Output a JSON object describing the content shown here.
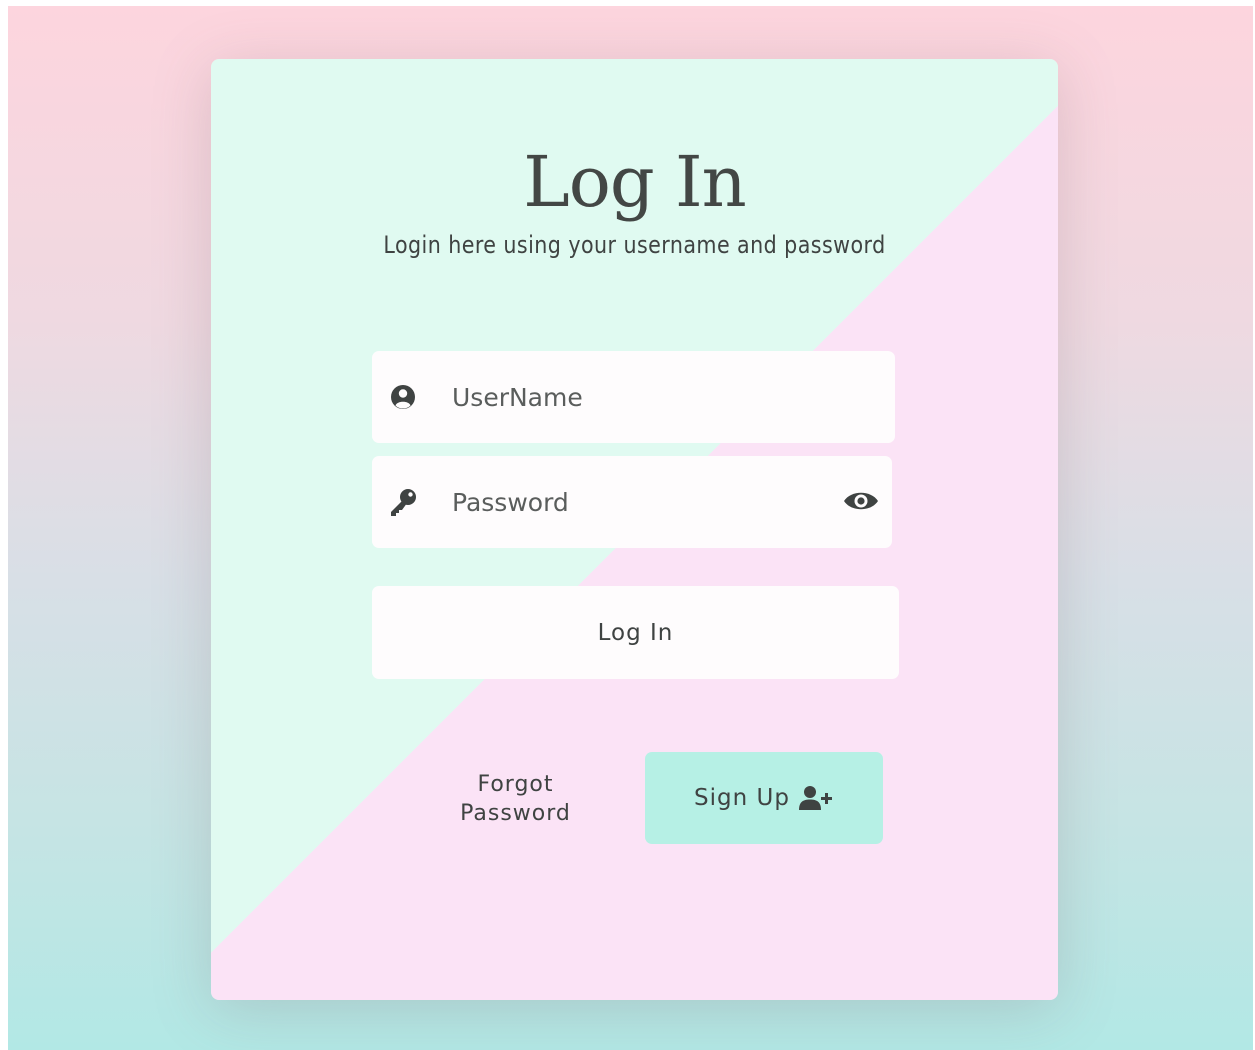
{
  "login": {
    "title": "Log In",
    "subtitle": "Login here using your username and password",
    "username_placeholder": "UserName",
    "password_placeholder": "Password",
    "submit_label": "Log In",
    "forgot_line1": "Forgot",
    "forgot_line2": "Password",
    "signup_label": "Sign Up"
  },
  "icons": {
    "username": "user-circle-icon",
    "password": "key-icon",
    "toggle": "eye-icon",
    "signup": "user-plus-icon"
  },
  "colors": {
    "card_mint": "#e0faf1",
    "card_pink": "#fbe3f6",
    "signup_button": "#b6f0e5",
    "text": "#3f4342"
  }
}
